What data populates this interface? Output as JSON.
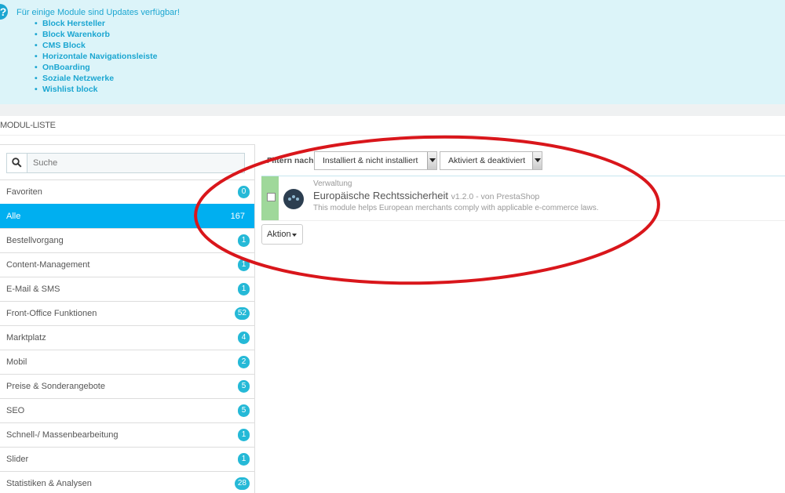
{
  "alert": {
    "icon": "question-icon",
    "title": "Für einige Module sind Updates verfügbar!",
    "modules": [
      "Block Hersteller",
      "Block Warenkorb",
      "CMS Block",
      "Horizontale Navigationsleiste",
      "OnBoarding",
      "Soziale Netzwerke",
      "Wishlist block"
    ]
  },
  "panel": {
    "title": "MODUL-LISTE"
  },
  "search": {
    "placeholder": "Suche",
    "icon": "search-icon"
  },
  "categories": [
    {
      "label": "Favoriten",
      "count": "0"
    },
    {
      "label": "Alle",
      "count": "167",
      "active": true
    },
    {
      "label": "Bestellvorgang",
      "count": "1"
    },
    {
      "label": "Content-Management",
      "count": "1"
    },
    {
      "label": "E-Mail & SMS",
      "count": "1"
    },
    {
      "label": "Front-Office Funktionen",
      "count": "52"
    },
    {
      "label": "Marktplatz",
      "count": "4"
    },
    {
      "label": "Mobil",
      "count": "2"
    },
    {
      "label": "Preise & Sonderangebote",
      "count": "5"
    },
    {
      "label": "SEO",
      "count": "5"
    },
    {
      "label": "Schnell-/ Massenbearbeitung",
      "count": "1"
    },
    {
      "label": "Slider",
      "count": "1"
    },
    {
      "label": "Statistiken & Analysen",
      "count": "28"
    }
  ],
  "filter": {
    "label": "Filtern nach",
    "install_select": "Installiert & nicht installiert",
    "active_select": "Aktiviert & deaktiviert"
  },
  "module": {
    "category": "Verwaltung",
    "name": "Europäische Rechtssicherheit",
    "version": "v1.2.0 - von PrestaShop",
    "description": "This module helps European merchants comply with applicable e-commerce laws.",
    "status_color": "#9fd89a"
  },
  "action": {
    "label": "Aktion"
  },
  "colors": {
    "accent": "#00aff0",
    "badge": "#25b9d7",
    "alert_bg": "#dcf4f9",
    "highlight": "#d9161b"
  }
}
